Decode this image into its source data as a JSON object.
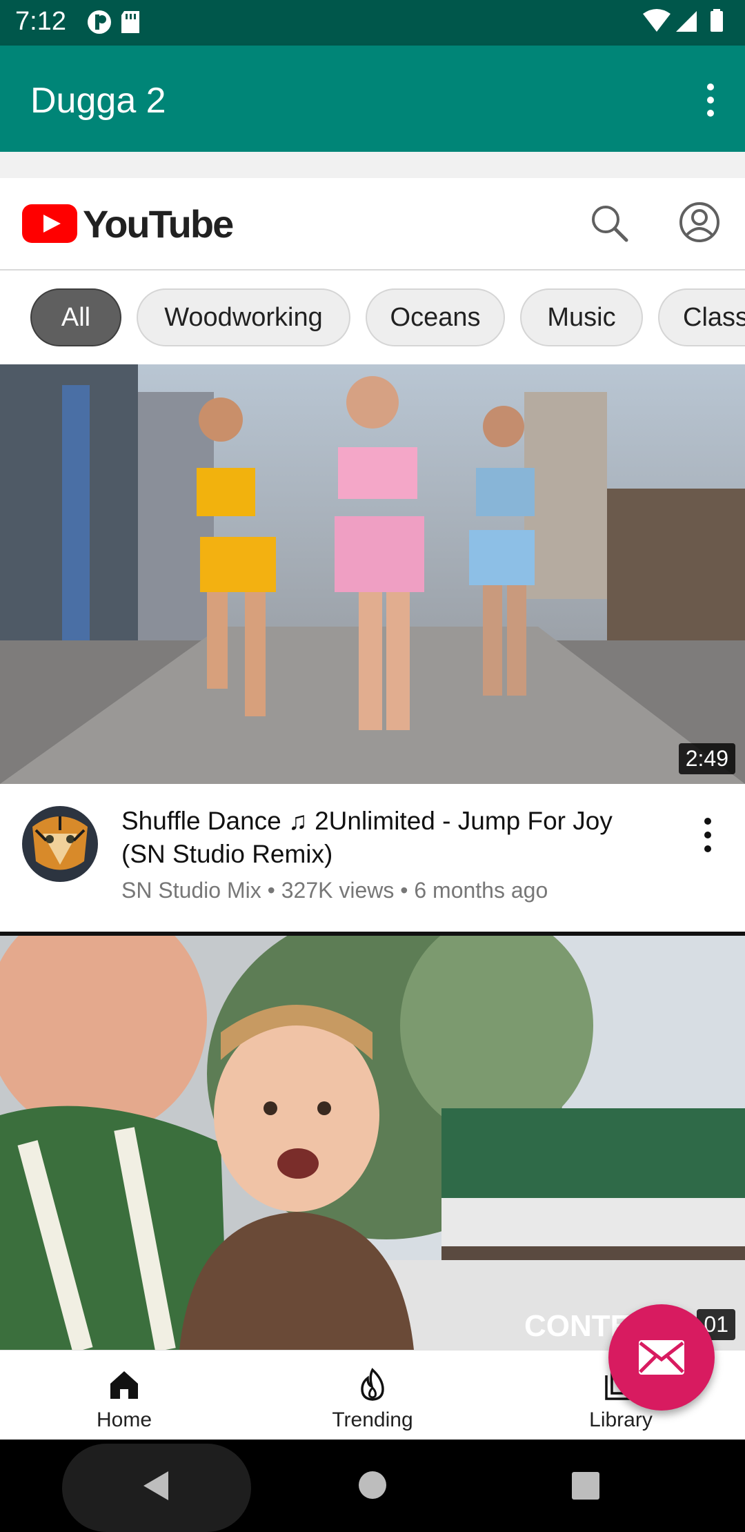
{
  "status_bar": {
    "time": "7:12"
  },
  "app_bar": {
    "title": "Dugga 2"
  },
  "youtube_header": {
    "logo_text": "YouTube"
  },
  "chips": [
    {
      "label": "All",
      "active": true
    },
    {
      "label": "Woodworking",
      "active": false
    },
    {
      "label": "Oceans",
      "active": false
    },
    {
      "label": "Music",
      "active": false
    },
    {
      "label": "Class",
      "active": false
    }
  ],
  "videos": [
    {
      "duration": "2:49",
      "title": "Shuffle Dance ♫ 2Unlimited - Jump For Joy (SN Studio Remix)",
      "channel": "SN Studio Mix",
      "views": "327K views",
      "age": "6 months ago"
    },
    {
      "duration": "01",
      "watermark": "CONTE"
    }
  ],
  "bottom_nav": {
    "items": [
      {
        "label": "Home",
        "icon": "home-icon"
      },
      {
        "label": "Trending",
        "icon": "trending-flame-icon"
      },
      {
        "label": "Library",
        "icon": "library-icon"
      }
    ]
  },
  "fab": {
    "icon": "mail-icon",
    "color": "#d81b60"
  },
  "colors": {
    "status_bar": "#00574b",
    "app_bar": "#008577",
    "youtube_red": "#ff0000"
  }
}
